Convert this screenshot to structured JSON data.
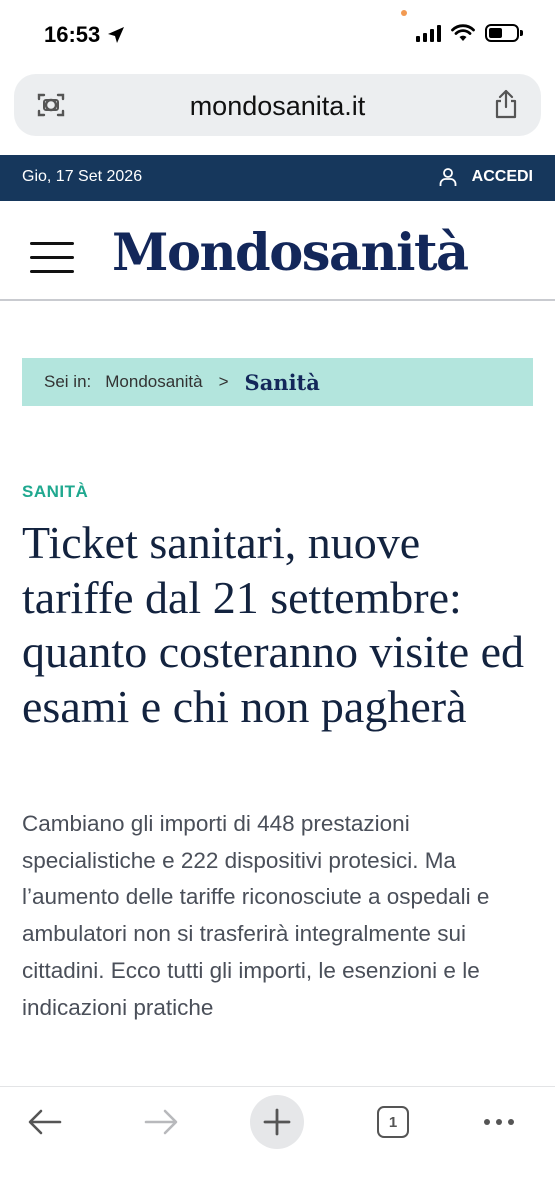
{
  "status_bar": {
    "time": "16:53"
  },
  "browser": {
    "url": "mondosanita.it",
    "tab_count": "1"
  },
  "top_bar": {
    "date": "Gio, 17 Set 2026",
    "login_label": "ACCEDI"
  },
  "header": {
    "logo": "Mondosanità"
  },
  "breadcrumb": {
    "prefix": "Sei in:",
    "home": "Mondosanità",
    "separator": ">",
    "current": "Sanità"
  },
  "article": {
    "category": "SANITÀ",
    "headline": "Ticket sanitari, nuove tariffe dal 21 settembre: quanto costeranno visite ed esami e chi non pagherà",
    "summary": "Cambiano gli importi di 448 prestazioni specialistiche e 222 dispositivi protesici. Ma l’aumento delle tariffe riconosciute a ospedali e ambulatori non si trasferirà integralmente sui cittadini. Ecco tutti gli importi, le esenzioni e le indicazioni pratiche"
  },
  "colors": {
    "navy": "#16375c",
    "breadcrumb_bg": "#b3e5dd",
    "category": "#1fa88f",
    "logo": "#13275a"
  },
  "icons": [
    "location-arrow-icon",
    "signal-icon",
    "wifi-icon",
    "battery-icon",
    "page-tools-icon",
    "share-icon",
    "user-icon",
    "menu-icon",
    "back-arrow-icon",
    "forward-arrow-icon",
    "plus-icon",
    "tabs-icon",
    "more-icon"
  ]
}
